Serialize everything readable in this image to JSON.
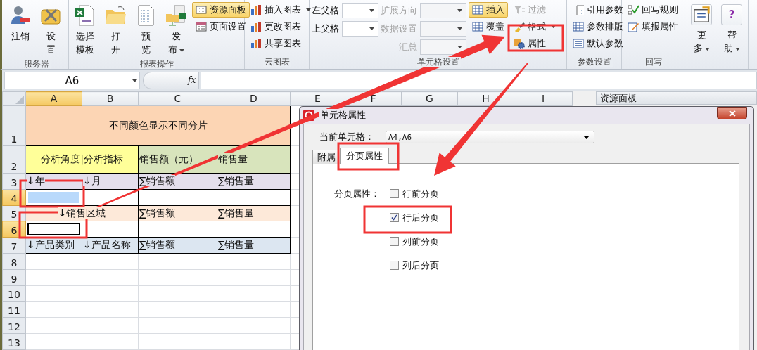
{
  "ribbon": {
    "groups": [
      {
        "label": "服务器",
        "columns": [
          [
            {
              "kind": "large",
              "lines": [
                "注销"
              ],
              "dropdown": false
            }
          ],
          [
            {
              "kind": "large",
              "lines": [
                "设",
                "置"
              ],
              "dropdown": false
            }
          ]
        ]
      },
      {
        "label": "报表操作",
        "columns": [
          [
            {
              "kind": "large",
              "lines": [
                "选择",
                "模板"
              ],
              "dropdown": false
            }
          ],
          [
            {
              "kind": "large",
              "lines": [
                "打",
                "开"
              ],
              "dropdown": false
            }
          ],
          [
            {
              "kind": "large",
              "lines": [
                "预",
                "览"
              ],
              "dropdown": false
            }
          ],
          [
            {
              "kind": "large",
              "lines": [
                "发",
                "布"
              ],
              "dropdown": true
            }
          ],
          [
            {
              "kind": "small",
              "label": "资源面板",
              "selected": true,
              "disabled": false,
              "dropdown": false
            },
            {
              "kind": "small",
              "label": "页面设置",
              "selected": false,
              "disabled": false,
              "dropdown": false
            }
          ]
        ]
      },
      {
        "label": "云图表",
        "columns": [
          [
            {
              "kind": "small",
              "label": "插入图表",
              "selected": false,
              "disabled": false,
              "dropdown": true
            },
            {
              "kind": "small",
              "label": "更改图表",
              "selected": false,
              "disabled": false,
              "dropdown": false
            },
            {
              "kind": "small",
              "label": "共享图表",
              "selected": false,
              "disabled": false,
              "dropdown": false
            }
          ]
        ]
      },
      {
        "label": "单元格设置",
        "columns": [
          [
            {
              "kind": "combo",
              "label": "左父格",
              "disabled": false
            },
            {
              "kind": "combo",
              "label": "上父格",
              "disabled": false
            }
          ],
          [
            {
              "kind": "combo",
              "label": "扩展方向",
              "disabled": true
            },
            {
              "kind": "combo",
              "label": "数据设置",
              "disabled": true
            },
            {
              "kind": "combo",
              "label": "汇总",
              "disabled": true
            }
          ],
          [
            {
              "kind": "small",
              "label": "插入",
              "selected": true,
              "disabled": false,
              "dropdown": false
            },
            {
              "kind": "small",
              "label": "覆盖",
              "selected": false,
              "disabled": false,
              "dropdown": false
            }
          ],
          [
            {
              "kind": "small",
              "label": "过滤",
              "selected": false,
              "disabled": true,
              "dropdown": false
            },
            {
              "kind": "small",
              "label": "格式",
              "selected": false,
              "disabled": false,
              "dropdown": true
            },
            {
              "kind": "small",
              "label": "属性",
              "selected": false,
              "disabled": false,
              "dropdown": false
            }
          ]
        ]
      },
      {
        "label": "参数设置",
        "columns": [
          [
            {
              "kind": "small",
              "label": "引用参数",
              "selected": false,
              "disabled": false,
              "dropdown": false
            },
            {
              "kind": "small",
              "label": "参数排版",
              "selected": false,
              "disabled": false,
              "dropdown": false
            },
            {
              "kind": "small",
              "label": "默认参数",
              "selected": false,
              "disabled": false,
              "dropdown": false
            }
          ]
        ]
      },
      {
        "label": "回写",
        "columns": [
          [
            {
              "kind": "small",
              "label": "回写规则",
              "selected": false,
              "disabled": false,
              "dropdown": false
            },
            {
              "kind": "small",
              "label": "填报属性",
              "selected": false,
              "disabled": false,
              "dropdown": false
            }
          ]
        ]
      },
      {
        "columns": [
          [
            {
              "kind": "large",
              "lines": [
                "更",
                "多"
              ],
              "dropdown": true
            }
          ]
        ]
      },
      {
        "columns": [
          [
            {
              "kind": "large",
              "lines": [
                "帮",
                "助"
              ],
              "dropdown": true,
              "icon_text": "?"
            }
          ]
        ]
      }
    ]
  },
  "formula_bar": {
    "name_box": "A6",
    "fx": "fx"
  },
  "sheet": {
    "columns": [
      {
        "label": "A",
        "selected": true
      },
      {
        "label": "B",
        "selected": false
      },
      {
        "label": "C",
        "selected": false
      },
      {
        "label": "D",
        "selected": false
      },
      {
        "label": "E",
        "selected": false
      },
      {
        "label": "F",
        "selected": false
      },
      {
        "label": "G",
        "selected": false
      },
      {
        "label": "H",
        "selected": false
      },
      {
        "label": "I",
        "selected": false
      }
    ],
    "rows": [
      {
        "label": "1",
        "kind": "title",
        "selected": false,
        "cells": [
          {
            "kind": "merged",
            "text": "不同颜色显示不同分片",
            "color": "#fcd5b4",
            "selected": false,
            "active": false
          }
        ]
      },
      {
        "label": "2",
        "kind": "header",
        "selected": false,
        "cells": [
          {
            "kind": "merged",
            "text": "分析角度|分析指标",
            "color": "#ffff99",
            "selected": false,
            "active": false
          },
          {
            "kind": "single",
            "text": "销售额（元）",
            "color": "#d8e4bc",
            "selected": false,
            "active": false
          },
          {
            "kind": "single",
            "text": "销售量",
            "color": "#d8e4bc",
            "selected": false,
            "active": false
          }
        ]
      },
      {
        "label": "3",
        "kind": "data",
        "selected": false,
        "cells": [
          {
            "kind": "single",
            "text": "↓年",
            "color": "#e4dfec",
            "selected": false,
            "active": false
          },
          {
            "kind": "single",
            "text": "↓月",
            "color": "#e4dfec",
            "selected": false,
            "active": false
          },
          {
            "kind": "single",
            "text": "∑销售额",
            "color": "#e4dfec",
            "selected": false,
            "active": false
          },
          {
            "kind": "single",
            "text": "∑销售量",
            "color": "#e4dfec",
            "selected": false,
            "active": false
          }
        ]
      },
      {
        "label": "4",
        "kind": "data",
        "selected": true,
        "cells": [
          {
            "kind": "single",
            "selected": true,
            "active": false
          },
          {
            "kind": "single",
            "selected": false,
            "active": false
          },
          {
            "kind": "single",
            "selected": false,
            "active": false
          },
          {
            "kind": "single",
            "selected": false,
            "active": false
          }
        ]
      },
      {
        "label": "5",
        "kind": "data",
        "selected": false,
        "cells": [
          {
            "kind": "merged",
            "text": "↓销售区域",
            "color": "#fde9d9",
            "selected": false,
            "active": false
          },
          {
            "kind": "single",
            "text": "∑销售额",
            "color": "#fde9d9",
            "selected": false,
            "active": false
          },
          {
            "kind": "single",
            "text": "∑销售量",
            "color": "#fde9d9",
            "selected": false,
            "active": false
          }
        ]
      },
      {
        "label": "6",
        "kind": "data",
        "selected": true,
        "cells": [
          {
            "kind": "single",
            "selected": false,
            "active": true
          },
          {
            "kind": "single",
            "selected": false,
            "active": false
          },
          {
            "kind": "single",
            "selected": false,
            "active": false
          },
          {
            "kind": "single",
            "selected": false,
            "active": false
          }
        ]
      },
      {
        "label": "7",
        "kind": "data",
        "selected": false,
        "cells": [
          {
            "kind": "single",
            "text": "↓产品类别",
            "color": "#dce6f1",
            "selected": false,
            "active": false
          },
          {
            "kind": "single",
            "text": "↓产品名称",
            "color": "#dce6f1",
            "selected": false,
            "active": false
          },
          {
            "kind": "single",
            "text": "∑销售额",
            "color": "#dce6f1",
            "selected": false,
            "active": false
          },
          {
            "kind": "single",
            "text": "∑销售量",
            "color": "#dce6f1",
            "selected": false,
            "active": false
          }
        ]
      },
      {
        "label": "8",
        "kind": "empty",
        "selected": false
      },
      {
        "label": "9",
        "kind": "empty",
        "selected": false
      },
      {
        "label": "10",
        "kind": "empty",
        "selected": false
      },
      {
        "label": "11",
        "kind": "empty",
        "selected": false
      },
      {
        "label": "12",
        "kind": "empty",
        "selected": false
      },
      {
        "label": "13",
        "kind": "empty",
        "selected": false
      }
    ]
  },
  "resource_panel": {
    "title": "资源面板"
  },
  "dialog": {
    "title": "单元格属性",
    "current_cell_label": "当前单元格：",
    "current_cell": "A4,A6",
    "tabs": [
      {
        "label": "附属",
        "selected": false
      },
      {
        "label": "分页属性",
        "selected": true
      }
    ],
    "section_label": "分页属性：",
    "options": [
      {
        "label": "行前分页",
        "checked": false
      },
      {
        "label": "行后分页",
        "checked": true
      },
      {
        "label": "列前分页",
        "checked": false
      },
      {
        "label": "列后分页",
        "checked": false
      }
    ]
  },
  "annotations": [
    {
      "kind": "box"
    },
    {
      "kind": "box"
    },
    {
      "kind": "box"
    },
    {
      "kind": "box"
    },
    {
      "kind": "box"
    },
    {
      "kind": "arrow"
    },
    {
      "kind": "arrow"
    }
  ]
}
